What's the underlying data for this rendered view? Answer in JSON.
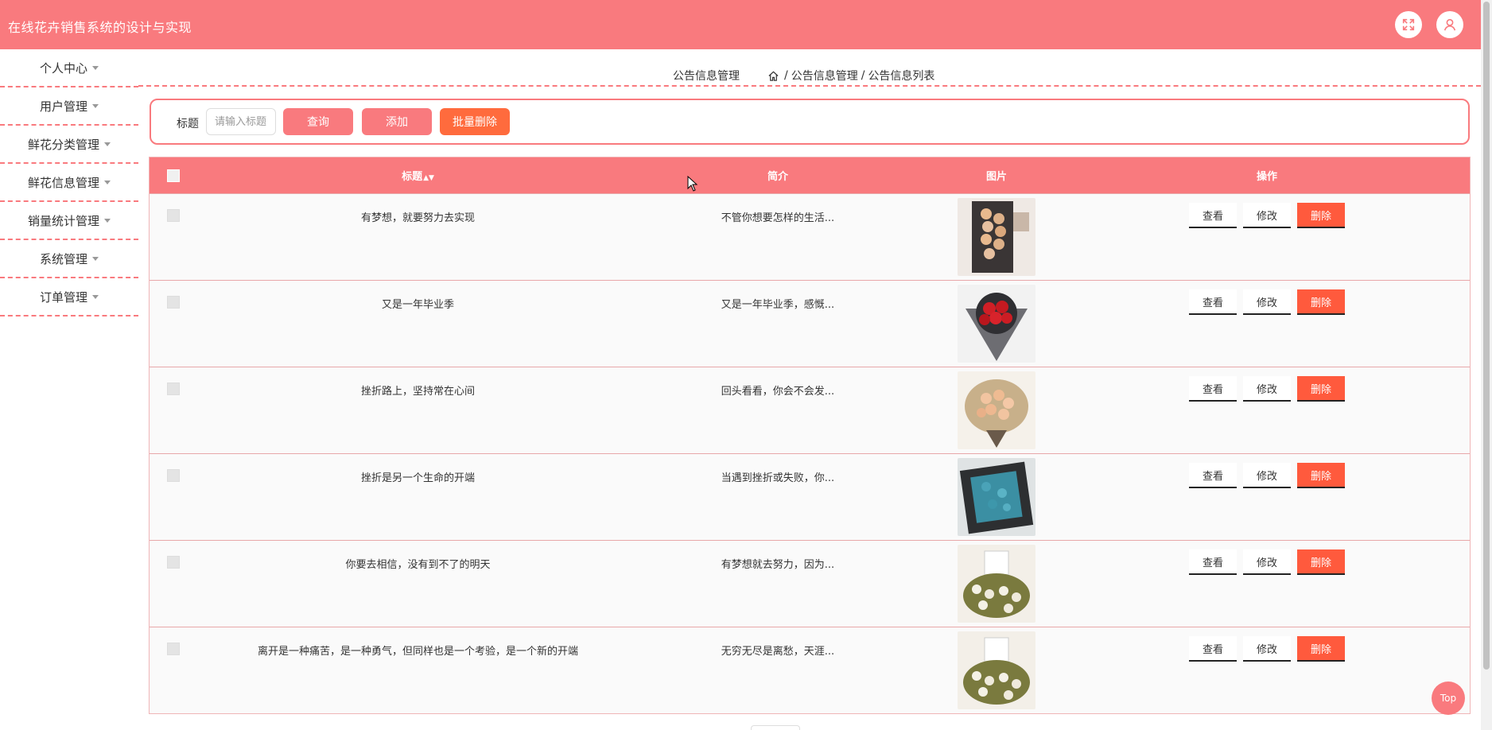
{
  "app": {
    "title": "在线花卉销售系统的设计与实现"
  },
  "header": {
    "fullscreen_icon": "fullscreen-icon",
    "user_icon": "user-icon"
  },
  "sidebar": {
    "items": [
      {
        "label": "个人中心"
      },
      {
        "label": "用户管理"
      },
      {
        "label": "鲜花分类管理"
      },
      {
        "label": "鲜花信息管理"
      },
      {
        "label": "销量统计管理"
      },
      {
        "label": "系统管理"
      },
      {
        "label": "订单管理"
      }
    ]
  },
  "page": {
    "heading": "公告信息管理",
    "breadcrumb": [
      "公告信息管理",
      "公告信息列表"
    ],
    "breadcrumb_sep": "/"
  },
  "search": {
    "label": "标题",
    "placeholder": "请输入标题",
    "query_label": "查询",
    "add_label": "添加",
    "batch_delete_label": "批量删除"
  },
  "table": {
    "columns": {
      "title": "标题",
      "brief": "简介",
      "image": "图片",
      "actions": "操作"
    },
    "actions": {
      "view": "查看",
      "edit": "修改",
      "delete": "删除"
    },
    "rows": [
      {
        "title": "有梦想，就要努力去实现",
        "brief": "不管你想要怎样的生活..."
      },
      {
        "title": "又是一年毕业季",
        "brief": "又是一年毕业季，感慨..."
      },
      {
        "title": "挫折路上，坚持常在心间",
        "brief": "回头看看，你会不会发..."
      },
      {
        "title": "挫折是另一个生命的开端",
        "brief": "当遇到挫折或失败，你..."
      },
      {
        "title": "你要去相信，没有到不了的明天",
        "brief": "有梦想就去努力，因为..."
      },
      {
        "title": "离开是一种痛苦，是一种勇气，但同样也是一个考验，是一个新的开端",
        "brief": "无穷无尽是离愁，天涯..."
      }
    ]
  },
  "back_to_top": {
    "label": "Top"
  },
  "colors": {
    "primary": "#f97a7e",
    "danger": "#ff5a3d",
    "batch": "#ff6b3d"
  }
}
